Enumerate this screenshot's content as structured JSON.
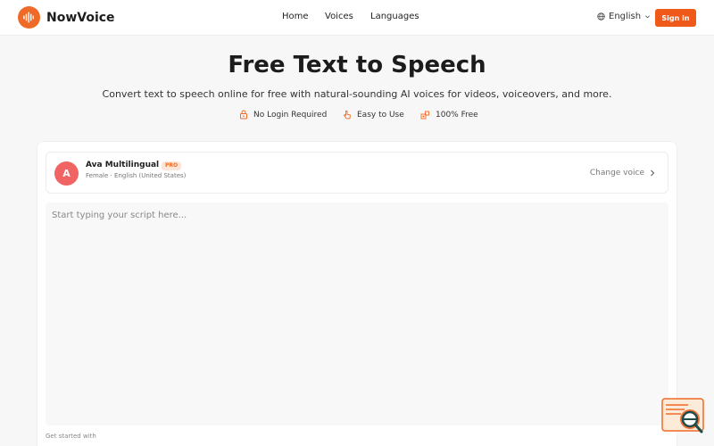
{
  "header": {
    "brand_name": "NowVoice",
    "nav": [
      {
        "label": "Home"
      },
      {
        "label": "Voices"
      },
      {
        "label": "Languages"
      }
    ],
    "language": "English",
    "signin_label": "Sign in",
    "accent_color": "#ef5a1b"
  },
  "hero": {
    "title": "Free Text to Speech",
    "subtitle": "Convert text to speech online for free with natural-sounding AI voices for videos, voiceovers, and more.",
    "features": [
      {
        "label": "No Login Required",
        "icon": "lock-icon"
      },
      {
        "label": "Easy to Use",
        "icon": "pointer-icon"
      },
      {
        "label": "100% Free",
        "icon": "coins-icon"
      }
    ]
  },
  "voice": {
    "avatar_letter": "A",
    "name": "Ava Multilingual",
    "badge": "PRO",
    "gender": "Female",
    "separator": "·",
    "locale": "English (United States)",
    "change_label": "Change voice"
  },
  "editor": {
    "placeholder": "Start typing your script here...",
    "value": ""
  },
  "footer_hint": "Get started with"
}
